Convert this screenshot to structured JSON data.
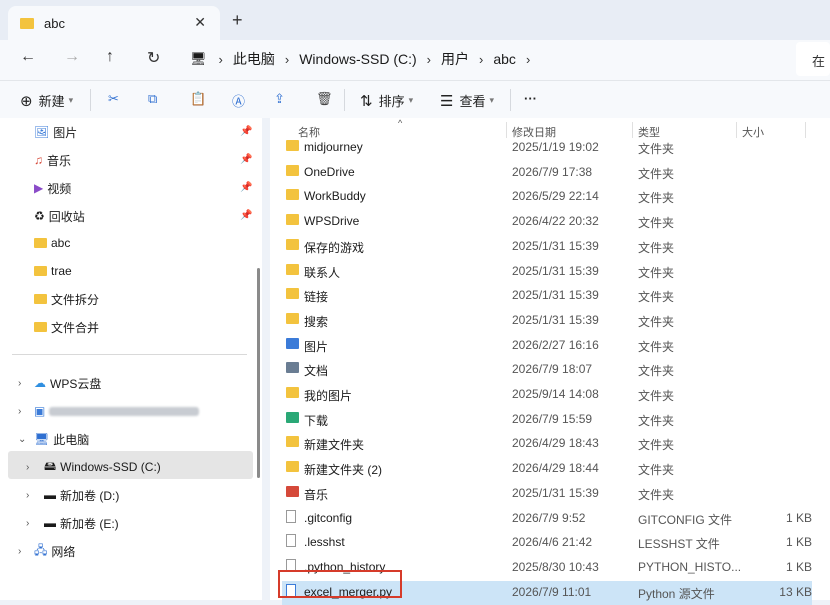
{
  "tab": {
    "title": "abc"
  },
  "address": {
    "crumbs": [
      "此电脑",
      "Windows-SSD (C:)",
      "用户",
      "abc"
    ],
    "search_placeholder": "在"
  },
  "toolbar": {
    "new_label": "新建",
    "sort_label": "排序",
    "view_label": "查看",
    "more_label": "···"
  },
  "sidebar": {
    "quick": [
      {
        "label": "图片",
        "icon": "pictures-icon",
        "pinned": true
      },
      {
        "label": "音乐",
        "icon": "music-icon",
        "pinned": true
      },
      {
        "label": "视频",
        "icon": "video-icon",
        "pinned": true
      },
      {
        "label": "回收站",
        "icon": "recycle-bin-icon",
        "pinned": true
      },
      {
        "label": "abc",
        "icon": "folder-icon",
        "pinned": false
      },
      {
        "label": "trae",
        "icon": "folder-icon",
        "pinned": false
      },
      {
        "label": "文件拆分",
        "icon": "folder-icon",
        "pinned": false
      },
      {
        "label": "文件合并",
        "icon": "folder-icon",
        "pinned": false
      }
    ],
    "tree": [
      {
        "label": "WPS云盘",
        "expanded": false
      },
      {
        "label": "",
        "expanded": false
      },
      {
        "label": "此电脑",
        "expanded": true
      },
      {
        "label": "Windows-SSD (C:)",
        "expanded": false,
        "selected": true
      },
      {
        "label": "新加卷 (D:)",
        "expanded": false
      },
      {
        "label": "新加卷 (E:)",
        "expanded": false
      },
      {
        "label": "网络",
        "expanded": false
      }
    ]
  },
  "columns": {
    "name": "名称",
    "date": "修改日期",
    "type": "类型",
    "size": "大小"
  },
  "files": [
    {
      "name": "midjourney",
      "date": "2025/1/19 19:02",
      "type": "文件夹",
      "size": "",
      "kind": "folder"
    },
    {
      "name": "OneDrive",
      "date": "2026/7/9 17:38",
      "type": "文件夹",
      "size": "",
      "kind": "folder"
    },
    {
      "name": "WorkBuddy",
      "date": "2026/5/29 22:14",
      "type": "文件夹",
      "size": "",
      "kind": "folder"
    },
    {
      "name": "WPSDrive",
      "date": "2026/4/22 20:32",
      "type": "文件夹",
      "size": "",
      "kind": "folder"
    },
    {
      "name": "保存的游戏",
      "date": "2025/1/31 15:39",
      "type": "文件夹",
      "size": "",
      "kind": "folder"
    },
    {
      "name": "联系人",
      "date": "2025/1/31 15:39",
      "type": "文件夹",
      "size": "",
      "kind": "folder"
    },
    {
      "name": "链接",
      "date": "2025/1/31 15:39",
      "type": "文件夹",
      "size": "",
      "kind": "folder"
    },
    {
      "name": "搜索",
      "date": "2025/1/31 15:39",
      "type": "文件夹",
      "size": "",
      "kind": "folder"
    },
    {
      "name": "图片",
      "date": "2026/2/27 16:16",
      "type": "文件夹",
      "size": "",
      "kind": "pictures"
    },
    {
      "name": "文档",
      "date": "2026/7/9 18:07",
      "type": "文件夹",
      "size": "",
      "kind": "documents"
    },
    {
      "name": "我的图片",
      "date": "2025/9/14 14:08",
      "type": "文件夹",
      "size": "",
      "kind": "folder"
    },
    {
      "name": "下载",
      "date": "2026/7/9 15:59",
      "type": "文件夹",
      "size": "",
      "kind": "downloads"
    },
    {
      "name": "新建文件夹",
      "date": "2026/4/29 18:43",
      "type": "文件夹",
      "size": "",
      "kind": "folder"
    },
    {
      "name": "新建文件夹 (2)",
      "date": "2026/4/29 18:44",
      "type": "文件夹",
      "size": "",
      "kind": "folder"
    },
    {
      "name": "音乐",
      "date": "2025/1/31 15:39",
      "type": "文件夹",
      "size": "",
      "kind": "music"
    },
    {
      "name": ".gitconfig",
      "date": "2026/7/9 9:52",
      "type": "GITCONFIG 文件",
      "size": "1 KB",
      "kind": "file"
    },
    {
      "name": ".lesshst",
      "date": "2026/4/6 21:42",
      "type": "LESSHST 文件",
      "size": "1 KB",
      "kind": "file"
    },
    {
      "name": ".python_history",
      "date": "2025/8/30 10:43",
      "type": "PYTHON_HISTO...",
      "size": "1 KB",
      "kind": "file"
    },
    {
      "name": "excel_merger.py",
      "date": "2026/7/9 11:01",
      "type": "Python 源文件",
      "size": "13 KB",
      "kind": "python",
      "selected": true
    }
  ],
  "colors": {
    "folder": "#f3c33e",
    "selection": "#cce4f7",
    "highlight_box": "#d63b2a",
    "accent": "#2f6fd1"
  }
}
